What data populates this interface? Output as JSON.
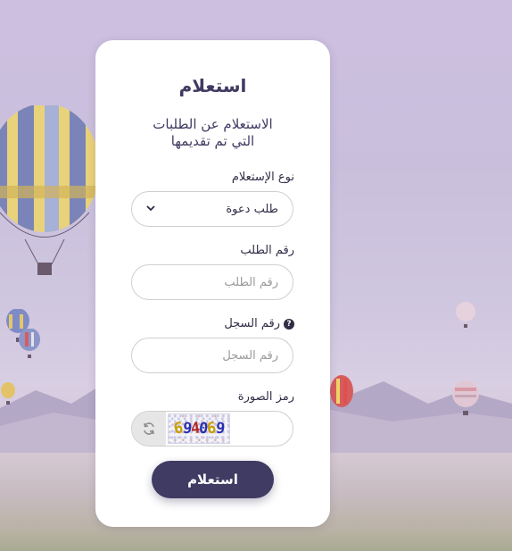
{
  "form": {
    "title": "استعلام",
    "subtitle_line1": "الاستعلام عن الطلبات",
    "subtitle_line2": "التي تم تقديمها",
    "inquiry_type_label": "نوع الإستعلام",
    "inquiry_type_selected": "طلب دعوة",
    "request_number_label": "رقم الطلب",
    "request_number_placeholder": "رقم الطلب",
    "request_number_value": "",
    "record_number_label": "رقم السجل",
    "record_number_placeholder": "رقم السجل",
    "record_number_value": "",
    "help_icon_glyph": "?",
    "captcha_label": "رمز الصورة",
    "captcha_value": "",
    "submit_label": "استعلام"
  },
  "captcha": {
    "chars": [
      {
        "char": "6",
        "color": "#c8a000"
      },
      {
        "char": "9",
        "color": "#2a2fb0"
      },
      {
        "char": "4",
        "color": "#b02a2a"
      },
      {
        "char": "0",
        "color": "#2a2fb0"
      },
      {
        "char": "6",
        "color": "#c8a000"
      },
      {
        "char": "9",
        "color": "#2a2fb0"
      }
    ]
  },
  "icons": {
    "select_chevron": "chevron-down-icon",
    "refresh": "refresh-icon",
    "help": "question-circle-icon"
  },
  "colors": {
    "primary": "#3f3b62",
    "background": "#cdbfe0",
    "card": "#ffffff"
  }
}
